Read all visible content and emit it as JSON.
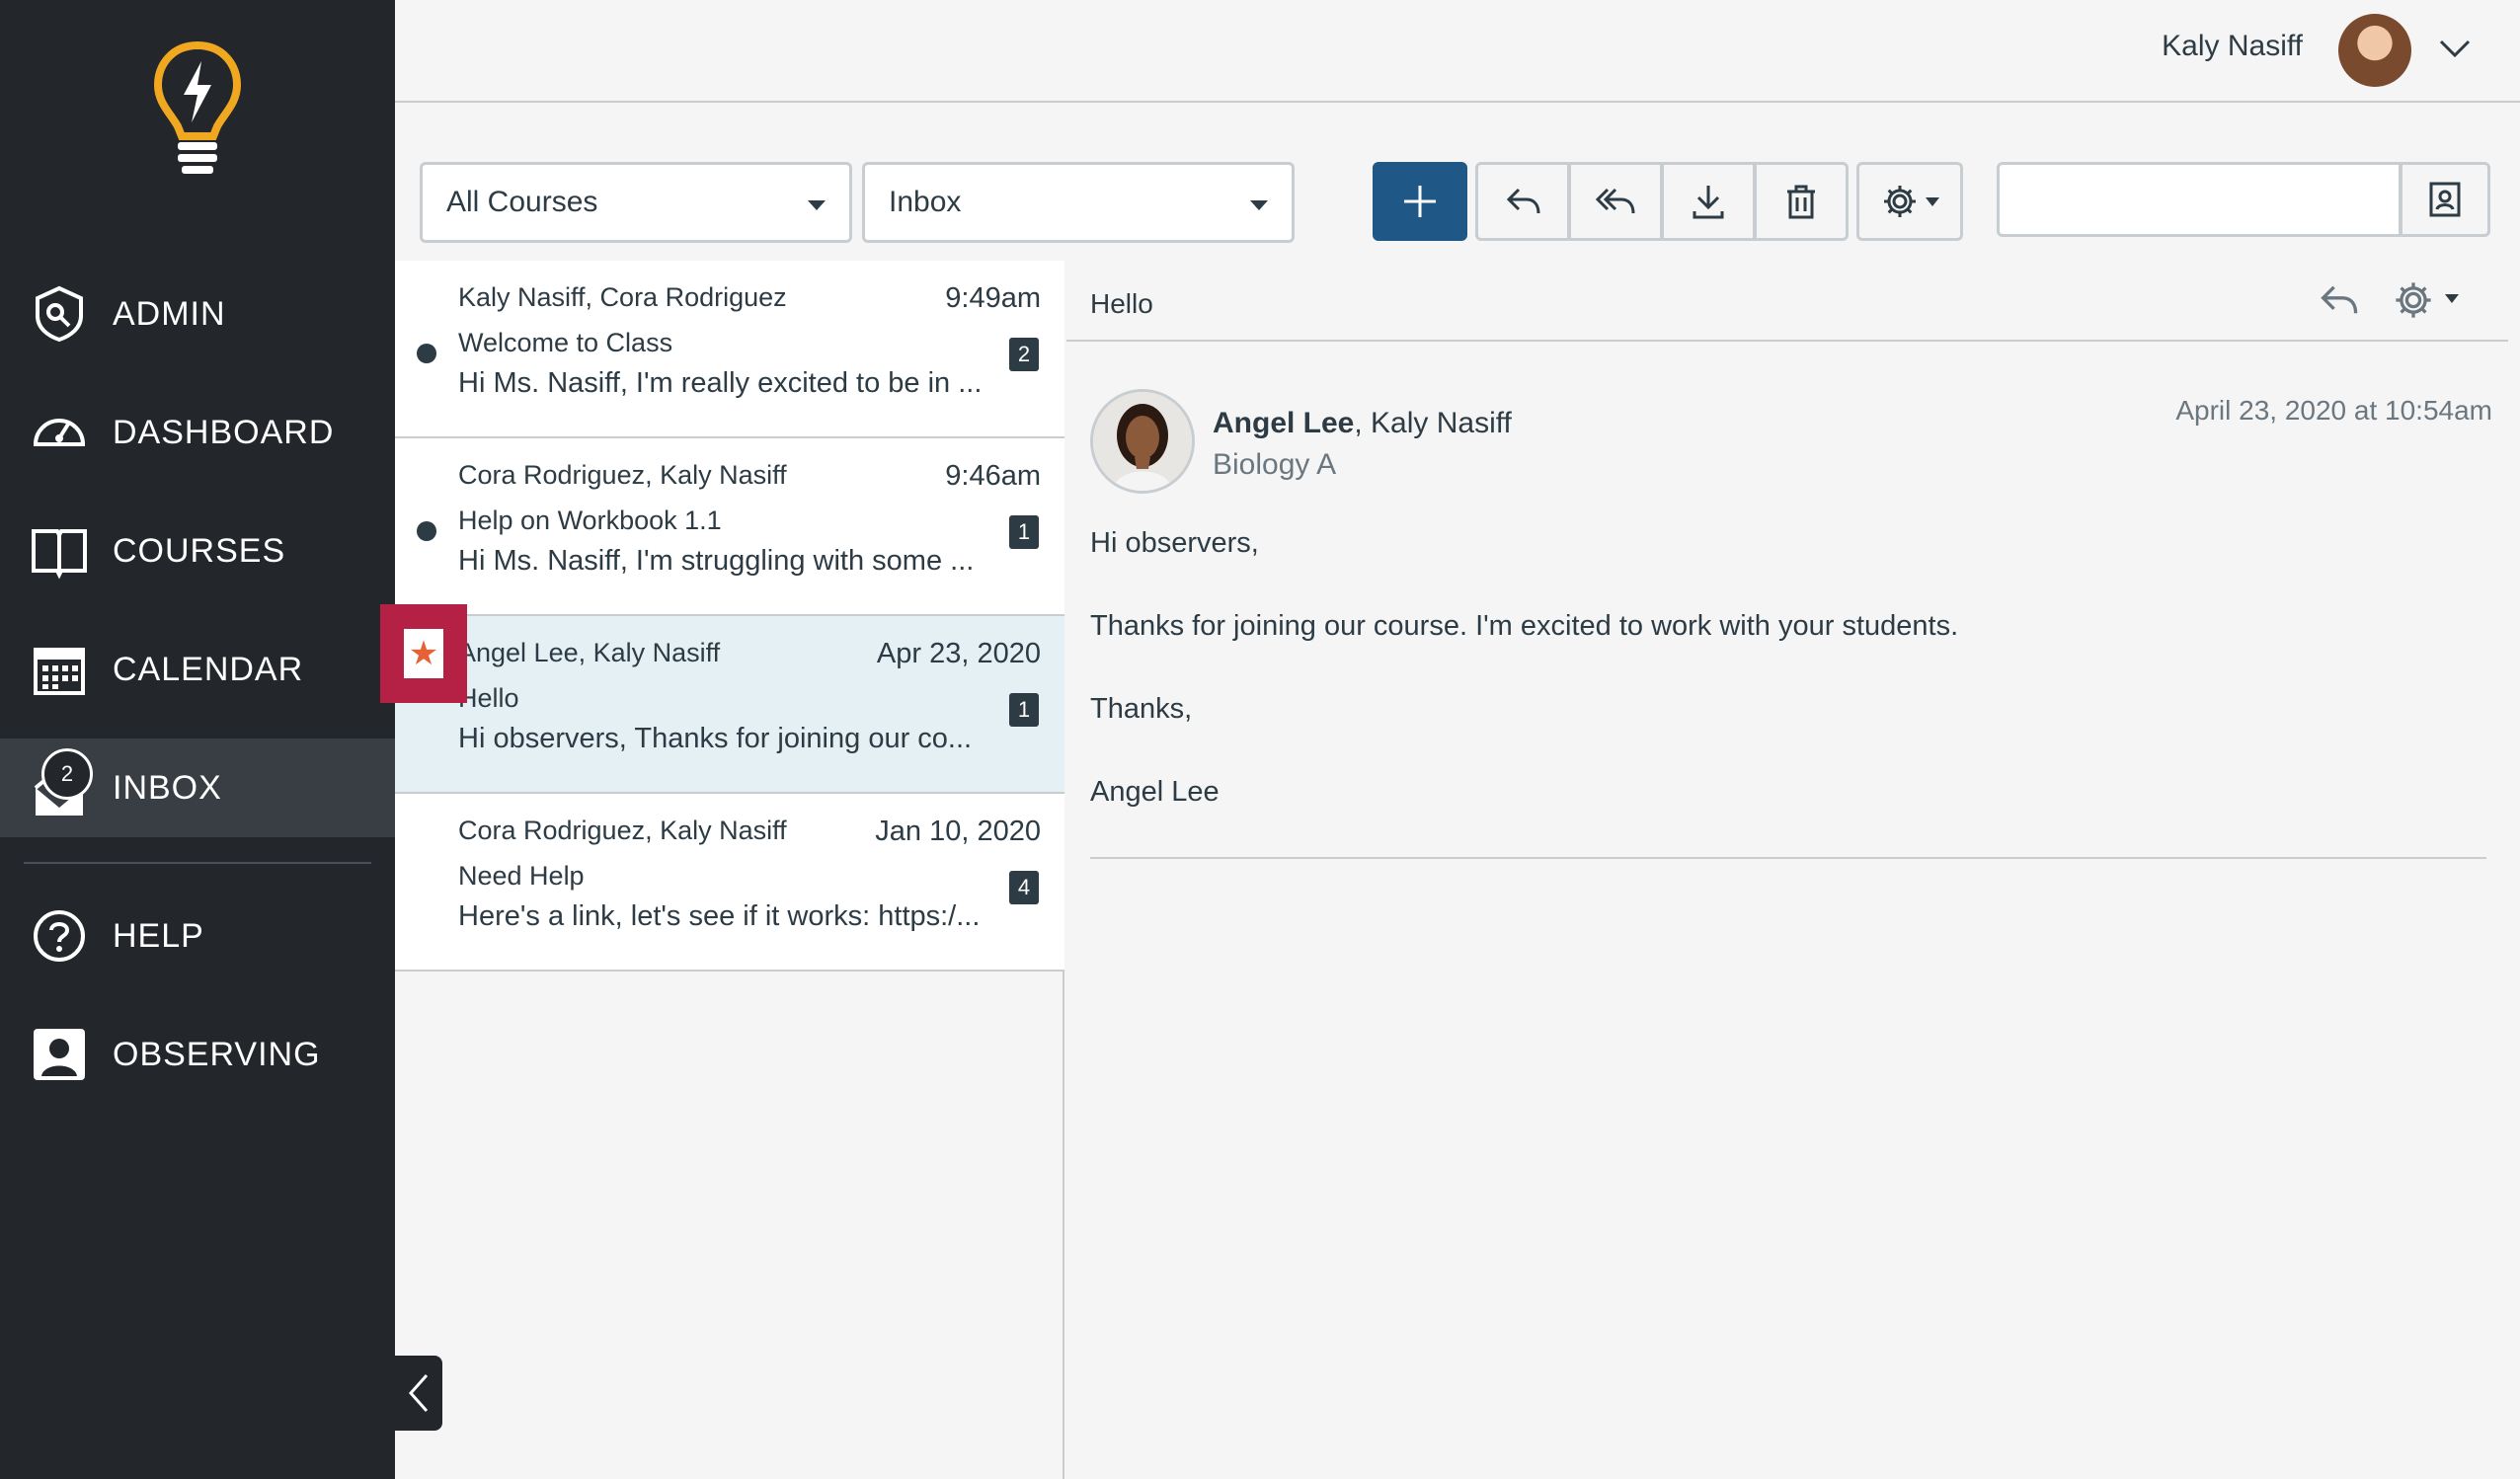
{
  "user": {
    "name": "Kaly Nasiff"
  },
  "nav": {
    "items": [
      {
        "label": "ADMIN",
        "icon": "admin-shield-icon"
      },
      {
        "label": "DASHBOARD",
        "icon": "dashboard-gauge-icon"
      },
      {
        "label": "COURSES",
        "icon": "book-icon"
      },
      {
        "label": "CALENDAR",
        "icon": "calendar-icon"
      },
      {
        "label": "INBOX",
        "icon": "inbox-icon",
        "badge": "2",
        "active": true
      },
      {
        "label": "HELP",
        "icon": "help-icon"
      },
      {
        "label": "OBSERVING",
        "icon": "observer-icon"
      }
    ]
  },
  "toolbar": {
    "course_filter": "All Courses",
    "mailbox_filter": "Inbox",
    "search_placeholder": ""
  },
  "messages": [
    {
      "from": "Kaly Nasiff, Cora Rodriguez",
      "date": "9:49am",
      "subject": "Welcome to Class",
      "preview": "Hi Ms. Nasiff, I'm really excited to be in ...",
      "count": "2",
      "unread": true
    },
    {
      "from": "Cora Rodriguez, Kaly Nasiff",
      "date": "9:46am",
      "subject": "Help on Workbook 1.1",
      "preview": "Hi Ms. Nasiff, I'm struggling with some ...",
      "count": "1",
      "unread": true
    },
    {
      "from": "Angel Lee, Kaly Nasiff",
      "date": "Apr 23, 2020",
      "subject": "Hello",
      "preview": "Hi observers, Thanks for joining our co...",
      "count": "1",
      "selected": true
    },
    {
      "from": "Cora Rodriguez, Kaly Nasiff",
      "date": "Jan 10, 2020",
      "subject": "Need Help",
      "preview": "Here's a link, let's see if it works: https:/...",
      "count": "4"
    }
  ],
  "conversation": {
    "title": "Hello",
    "sender_bold": "Angel Lee",
    "sender_rest": ", Kaly Nasiff",
    "course": "Biology A",
    "date": "April 23, 2020 at 10:54am",
    "body": [
      "Hi observers,",
      "Thanks for joining our course. I'm excited to work with your students.",
      "Thanks,",
      "Angel Lee"
    ]
  },
  "colors": {
    "sidebar": "#23262b",
    "primary": "#1f5887",
    "star_highlight": "#b52145",
    "star": "#e66135"
  }
}
